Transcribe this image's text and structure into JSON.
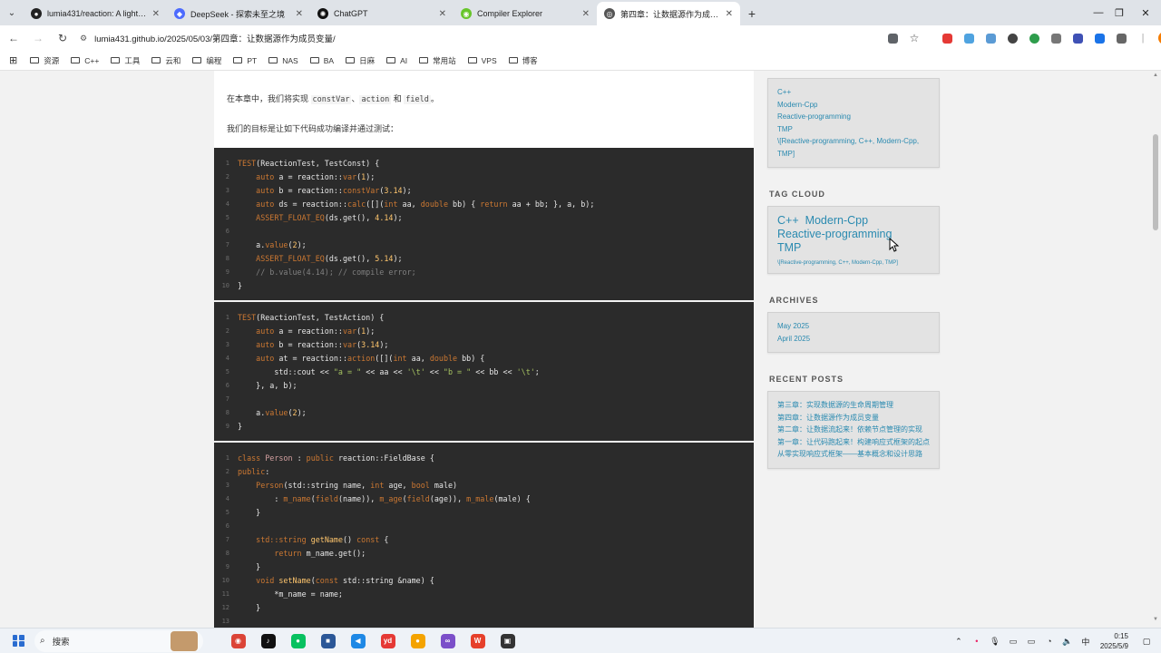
{
  "browser": {
    "tabs": [
      {
        "label": "lumia431/reaction: A lightweight",
        "icon": "github-icon",
        "color": "#222222",
        "glyph": "●"
      },
      {
        "label": "DeepSeek - 探索未至之境",
        "icon": "deepseek-icon",
        "color": "#4d6bfe",
        "glyph": "◆"
      },
      {
        "label": "ChatGPT",
        "icon": "chatgpt-icon",
        "color": "#111111",
        "glyph": "✺"
      },
      {
        "label": "Compiler Explorer",
        "icon": "compiler-explorer-icon",
        "color": "#67c52a",
        "glyph": "◉"
      },
      {
        "label": "第四章：让数据源作为成员变量",
        "icon": "blog-icon",
        "color": "#555555",
        "glyph": "◎",
        "active": true
      }
    ],
    "new_tab": "+",
    "url": "lumia431.github.io/2025/05/03/第四章：让数据源作为成员变量/",
    "bookmarks": [
      "资源",
      "C++",
      "工具",
      "云和",
      "编程",
      "PT",
      "NAS",
      "BA",
      "日麻",
      "AI",
      "常用站",
      "VPS",
      "博客"
    ]
  },
  "article": {
    "intro_pre": "在本章中，我们将实现 ",
    "code1": "constVar",
    "sep1": "、",
    "code2": "action",
    "sep2": " 和 ",
    "code3": "field",
    "intro_post": "。",
    "goal": "我们的目标是让如下代码成功编译并通过测试："
  },
  "code_blocks": [
    {
      "lines": [
        {
          "n": "1",
          "html": "<span class=\"kw\">TEST</span>(ReactionTest, TestConst) {"
        },
        {
          "n": "2",
          "html": "    <span class=\"kw\">auto</span> a = reaction::<span class=\"kw\">var</span>(<span class=\"num\">1</span>);"
        },
        {
          "n": "3",
          "html": "    <span class=\"kw\">auto</span> b = reaction::<span class=\"kw\">constVar</span>(<span class=\"num\">3.14</span>);"
        },
        {
          "n": "4",
          "html": "    <span class=\"kw\">auto</span> ds = reaction::<span class=\"kw\">calc</span>([](<span class=\"kw\">int</span> aa, <span class=\"kw\">double</span> bb) { <span class=\"kw\">return</span> aa + bb; }, a, b);"
        },
        {
          "n": "5",
          "html": "    <span class=\"kw\">ASSERT_FLOAT_EQ</span>(ds.get(), <span class=\"num\">4.14</span>);"
        },
        {
          "n": "6",
          "html": ""
        },
        {
          "n": "7",
          "html": "    a.<span class=\"kw\">value</span>(<span class=\"num\">2</span>);"
        },
        {
          "n": "8",
          "html": "    <span class=\"kw\">ASSERT_FLOAT_EQ</span>(ds.get(), <span class=\"num\">5.14</span>);"
        },
        {
          "n": "9",
          "html": "    <span class=\"cm\">// b.value(4.14); // compile error;</span>"
        },
        {
          "n": "10",
          "html": "}"
        }
      ]
    },
    {
      "lines": [
        {
          "n": "1",
          "html": "<span class=\"kw\">TEST</span>(ReactionTest, TestAction) {"
        },
        {
          "n": "2",
          "html": "    <span class=\"kw\">auto</span> a = reaction::<span class=\"kw\">var</span>(<span class=\"num\">1</span>);"
        },
        {
          "n": "3",
          "html": "    <span class=\"kw\">auto</span> b = reaction::<span class=\"kw\">var</span>(<span class=\"num\">3.14</span>);"
        },
        {
          "n": "4",
          "html": "    <span class=\"kw\">auto</span> at = reaction::<span class=\"kw\">action</span>([](<span class=\"kw\">int</span> aa, <span class=\"kw\">double</span> bb) {"
        },
        {
          "n": "5",
          "html": "        std::cout << <span class=\"str\">\"a = \"</span> << aa << <span class=\"str\">'\\t'</span> << <span class=\"str\">\"b = \"</span> << bb << <span class=\"str\">'\\t'</span>;"
        },
        {
          "n": "6",
          "html": "    }, a, b);"
        },
        {
          "n": "7",
          "html": ""
        },
        {
          "n": "8",
          "html": "    a.<span class=\"kw\">value</span>(<span class=\"num\">2</span>);"
        },
        {
          "n": "9",
          "html": "}"
        }
      ]
    },
    {
      "lines": [
        {
          "n": "1",
          "html": "<span class=\"kw\">class</span> <span class=\"ty\">Person</span> : <span class=\"kw\">public</span> reaction::FieldBase {"
        },
        {
          "n": "2",
          "html": "<span class=\"kw\">public</span>:"
        },
        {
          "n": "3",
          "html": "    <span class=\"kw\">Person</span>(std::string name, <span class=\"kw\">int</span> age, <span class=\"kw\">bool</span> male)"
        },
        {
          "n": "4",
          "html": "        : <span class=\"kw\">m_name</span>(<span class=\"kw\">field</span>(name)), <span class=\"kw\">m_age</span>(<span class=\"kw\">field</span>(age)), <span class=\"kw\">m_male</span>(male) {"
        },
        {
          "n": "5",
          "html": "    }"
        },
        {
          "n": "6",
          "html": ""
        },
        {
          "n": "7",
          "html": "    <span class=\"kw\">std::string</span> <span class=\"fn\">getName</span>() <span class=\"kw\">const</span> {"
        },
        {
          "n": "8",
          "html": "        <span class=\"kw\">return</span> m_name.get();"
        },
        {
          "n": "9",
          "html": "    }"
        },
        {
          "n": "10",
          "html": "    <span class=\"kw\">void</span> <span class=\"fn\">setName</span>(<span class=\"kw\">const</span> std::string &amp;name) {"
        },
        {
          "n": "11",
          "html": "        *m_name = name;"
        },
        {
          "n": "12",
          "html": "    }"
        },
        {
          "n": "13",
          "html": ""
        }
      ]
    }
  ],
  "sidebar": {
    "tags_list": [
      "C++",
      "Modern-Cpp",
      "Reactive-programming",
      "TMP",
      "\\[Reactive-programming, C++, Modern-Cpp, TMP]"
    ],
    "tag_cloud_title": "TAG CLOUD",
    "tag_cloud_line1": "C++  Modern-Cpp",
    "tag_cloud_line2": "Reactive-programming",
    "tag_cloud_line3": "TMP",
    "tag_cloud_small": "\\[Reactive-programming, C++, Modern-Cpp, TMP]",
    "archives_title": "ARCHIVES",
    "archives": [
      "May 2025",
      "April 2025"
    ],
    "recent_title": "RECENT POSTS",
    "recent": [
      "第三章：实现数据源的生命周期管理",
      "第四章：让数据源作为成员变量",
      "第二章：让数据流起来！依赖节点管理的实现",
      "第一章：让代码跑起来！构建响应式框架的起点",
      "从零实现响应式框架——基本概念和设计思路"
    ]
  },
  "taskbar": {
    "search": "搜索",
    "apps": [
      {
        "name": "chrome-icon",
        "color": "#db4437",
        "glyph": "◉"
      },
      {
        "name": "tiktok-icon",
        "color": "#111111",
        "glyph": "♪"
      },
      {
        "name": "wechat-icon",
        "color": "#07c160",
        "glyph": "●"
      },
      {
        "name": "files-icon",
        "color": "#2b5797",
        "glyph": "■"
      },
      {
        "name": "vscode-icon",
        "color": "#1e88e5",
        "glyph": "◀"
      },
      {
        "name": "youdao-icon",
        "color": "#e53935",
        "glyph": "yd"
      },
      {
        "name": "search-app-icon",
        "color": "#f4a300",
        "glyph": "●"
      },
      {
        "name": "visual-studio-icon",
        "color": "#7b4fc9",
        "glyph": "∞"
      },
      {
        "name": "wps-icon",
        "color": "#e6402b",
        "glyph": "W"
      },
      {
        "name": "terminal-icon",
        "color": "#333333",
        "glyph": "▣"
      }
    ],
    "ime": "中",
    "time": "0:15",
    "date": "2025/5/9"
  }
}
